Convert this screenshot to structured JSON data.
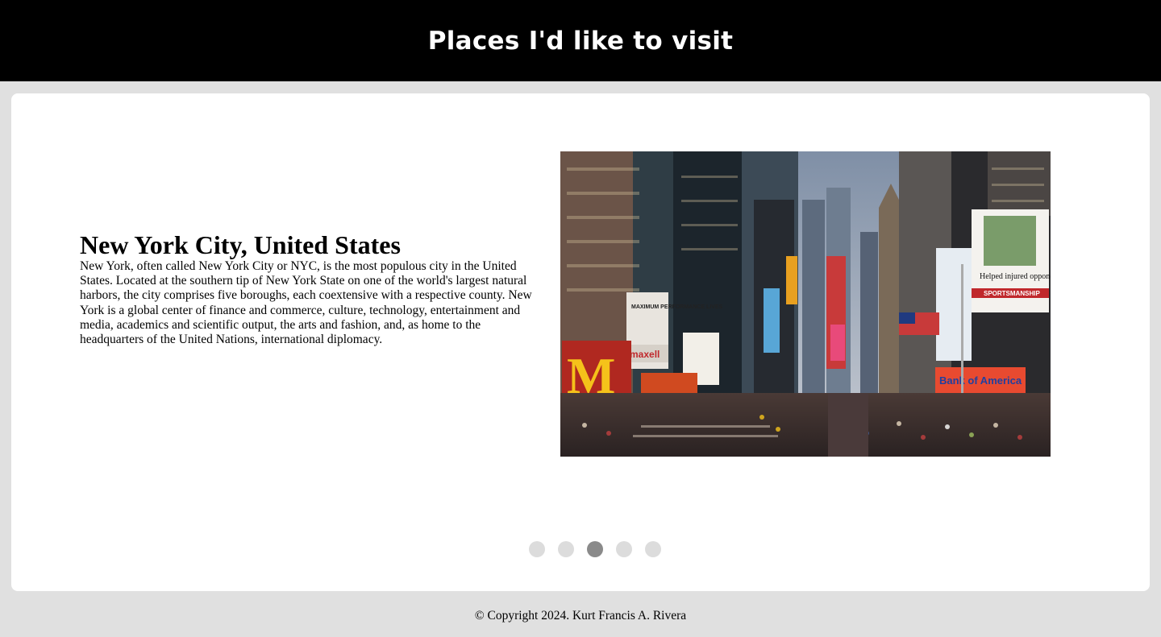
{
  "header": {
    "title": "Places I'd like to visit"
  },
  "slide": {
    "title": "New York City, United States",
    "description": "New York, often called New York City or NYC, is the most populous city in the United States. Located at the southern tip of New York State on one of the world's largest natural harbors, the city comprises five boroughs, each coextensive with a respective county. New York is a global center of finance and commerce, culture, technology, entertainment and media, academics and scientific output, the arts and fashion, and, as home to the headquarters of the United Nations, international diplomacy.",
    "image": {
      "billboard_text": "Helped injured opponent win.",
      "sign_1": "maxell",
      "sign_2": "MAXIMUM PERFORMANCE LIVES",
      "sign_3": "SPORTSMANSHIP",
      "sign_4": "Bank of America"
    }
  },
  "carousel": {
    "total": 5,
    "active_index": 2
  },
  "footer": {
    "text": "© Copyright 2024. Kurt Francis A. Rivera"
  },
  "colors": {
    "header_bg": "#000000",
    "page_bg": "#e0e0e0",
    "card_bg": "#ffffff",
    "dot_inactive": "#dcdcdc",
    "dot_active": "#8a8a8a"
  }
}
